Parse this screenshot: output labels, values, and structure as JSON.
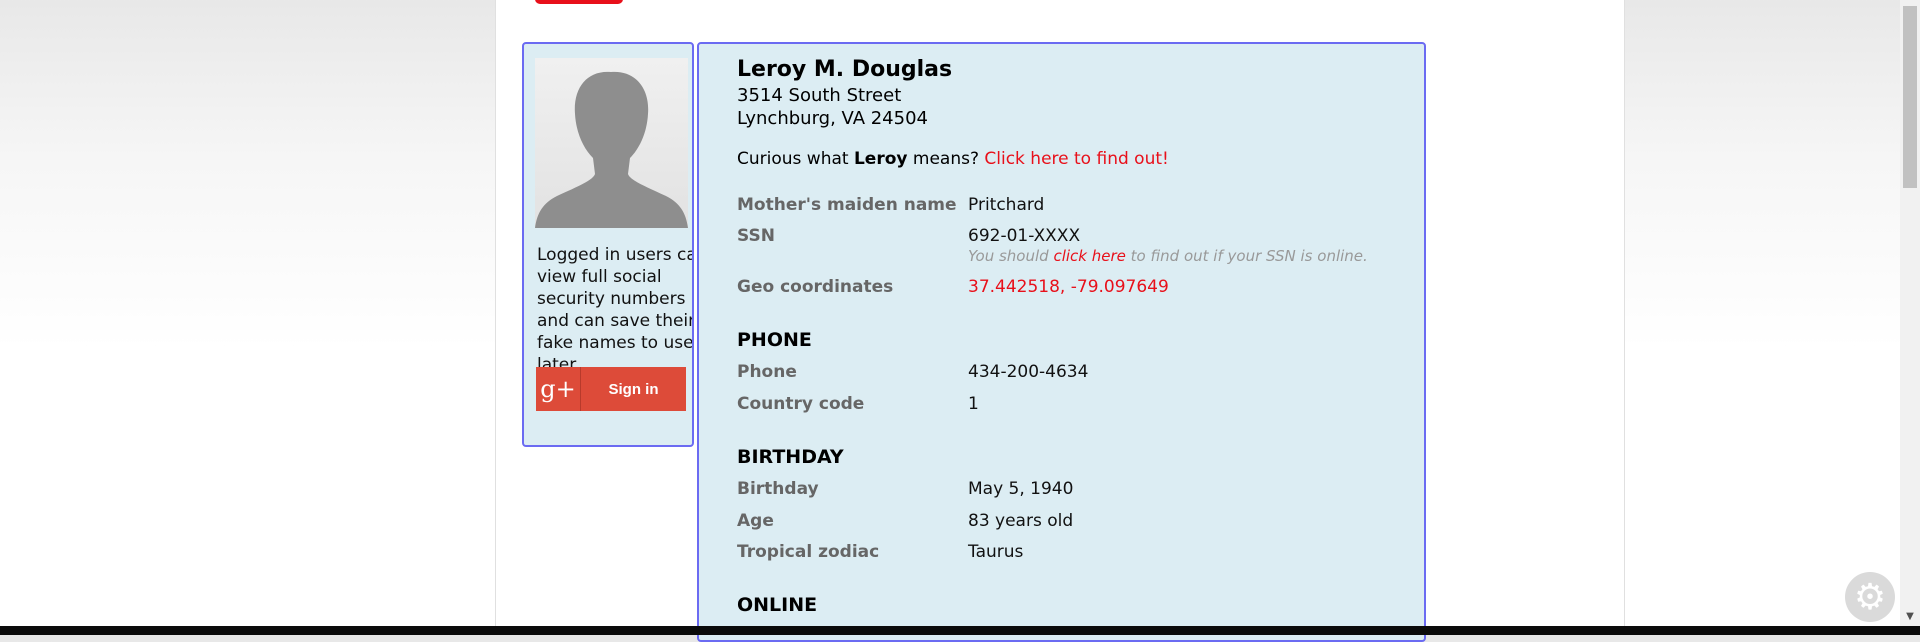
{
  "login_panel": {
    "text": "Logged in users can view full social security numbers and can save their fake names to use later.",
    "signin_label": "Sign in",
    "gplus_glyph": "g+"
  },
  "person": {
    "name": "Leroy M. Douglas",
    "street": "3514 South Street",
    "city_state_zip": "Lynchburg, VA 24504",
    "curious_prefix": "Curious what",
    "first_name": "Leroy",
    "curious_suffix": "means?",
    "curious_link": "Click here to find out!"
  },
  "details": {
    "maiden_label": "Mother's maiden name",
    "maiden_value": "Pritchard",
    "ssn_label": "SSN",
    "ssn_value": "692-01-XXXX",
    "ssn_note_prefix": "You should",
    "ssn_note_link": "click here",
    "ssn_note_suffix": "to find out if your SSN is online.",
    "geo_label": "Geo coordinates",
    "geo_value": "37.442518, -79.097649"
  },
  "phone": {
    "heading": "PHONE",
    "phone_label": "Phone",
    "phone_value": "434-200-4634",
    "country_label": "Country code",
    "country_value": "1"
  },
  "birthday": {
    "heading": "BIRTHDAY",
    "birthday_label": "Birthday",
    "birthday_value": "May 5, 1940",
    "age_label": "Age",
    "age_value": "83 years old",
    "zodiac_label": "Tropical zodiac",
    "zodiac_value": "Taurus"
  },
  "online": {
    "heading": "ONLINE"
  },
  "colors": {
    "accent_red": "#e8101a",
    "panel_bg": "#dcedf3",
    "panel_border": "#6b6bf2",
    "gplus_red": "#dd4b39"
  },
  "icons": {
    "settings": "gear-icon",
    "scroll_down": "chevron-down-icon"
  }
}
